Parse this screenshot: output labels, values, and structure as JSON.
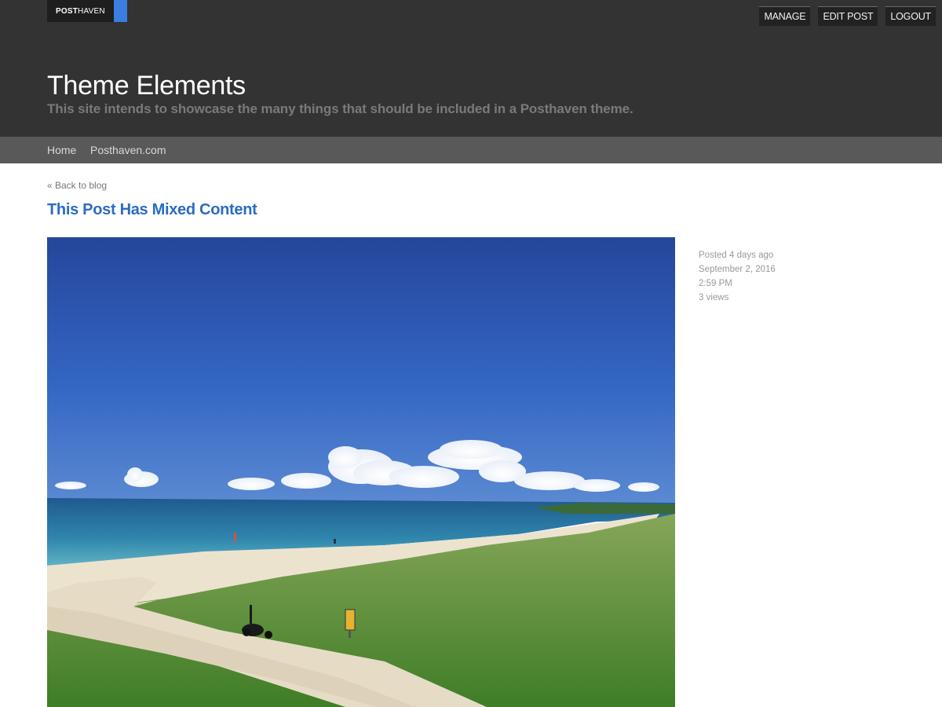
{
  "brand": {
    "bold": "POST",
    "light": "HAVEN"
  },
  "admin": {
    "manage": "MANAGE",
    "edit_post": "EDIT POST",
    "logout": "LOGOUT"
  },
  "site": {
    "title": "Theme Elements",
    "description": "This site intends to showcase the many things that should be included in a Posthaven theme."
  },
  "nav": {
    "items": [
      {
        "label": "Home"
      },
      {
        "label": "Posthaven.com"
      }
    ]
  },
  "post": {
    "back_link": "« Back to blog",
    "title": "This Post Has Mixed Content",
    "meta": {
      "posted": "Posted 4 days ago",
      "date": "September 2, 2016",
      "time": "2:59 PM",
      "views": "3 views"
    }
  },
  "colors": {
    "header_bg": "#333333",
    "nav_bg": "#595959",
    "accent": "#3a7ee0",
    "post_title": "#2a6cc4"
  }
}
